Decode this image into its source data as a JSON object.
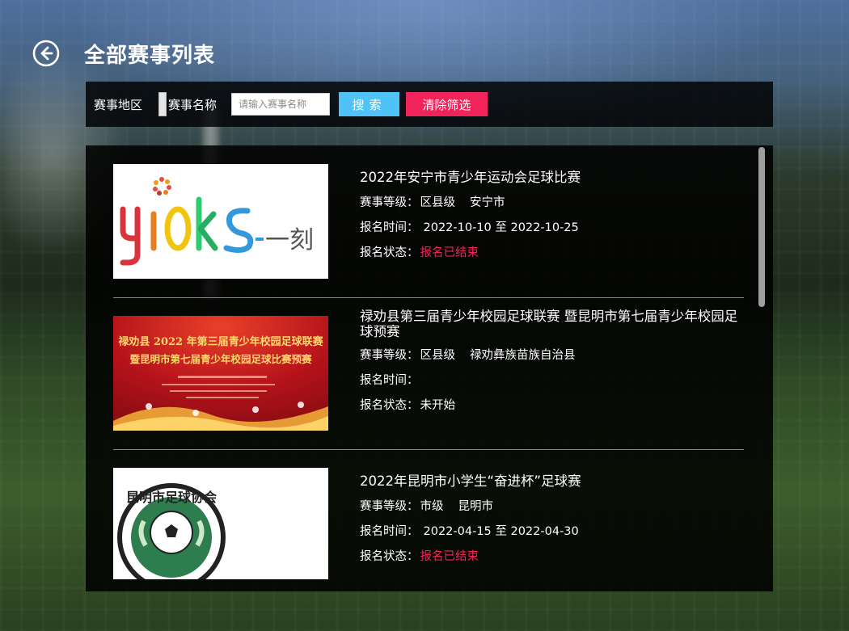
{
  "header": {
    "title": "全部赛事列表"
  },
  "filters": {
    "region_label": "赛事地区",
    "name_label": "赛事名称",
    "name_placeholder": "请输入赛事名称",
    "search_label": "搜索",
    "clear_label": "清除筛选"
  },
  "labels": {
    "level": "赛事等级：",
    "time": "报名时间：",
    "status": "报名状态："
  },
  "events": [
    {
      "title": "2022年安宁市青少年运动会足球比赛",
      "level": "区县级",
      "region": "安宁市",
      "time": "2022-10-10 至 2022-10-25",
      "status": "报名已结束",
      "status_color": "#f0245a",
      "thumb_text_main": "yiOks",
      "thumb_text_sub": "一刻"
    },
    {
      "title": "禄劝县第三届青少年校园足球联赛 暨昆明市第七届青少年校园足球预赛",
      "level": "区县级",
      "region": "禄劝彝族苗族自治县",
      "time": "",
      "status": "未开始",
      "status_color": "#ffffff",
      "thumb_line1": "禄劝县 2022 年第三届青少年校园足球联赛",
      "thumb_line2": "暨昆明市第七届青少年校园足球比赛预赛"
    },
    {
      "title": "2022年昆明市小学生“奋进杯”足球赛",
      "level": "市级",
      "region": "昆明市",
      "time": "2022-04-15 至 2022-04-30",
      "status": "报名已结束",
      "status_color": "#f0245a",
      "thumb_text": "昆明市足球协会",
      "thumb_text_en": "KUNMING ... ASSOCIATION"
    }
  ]
}
